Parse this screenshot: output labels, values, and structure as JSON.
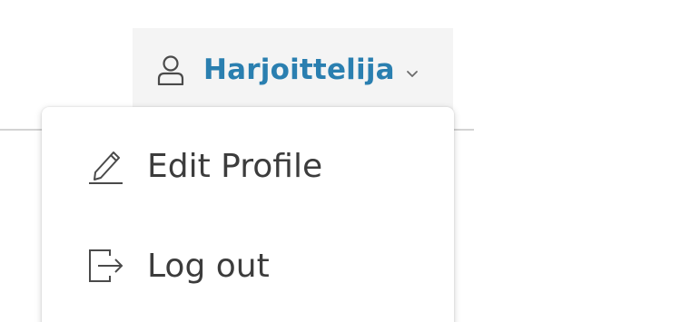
{
  "user_menu": {
    "username": "Harjoittelija",
    "user_icon": "user-icon",
    "chevron_icon": "chevron-down-icon",
    "accent_color": "#2a7fb0"
  },
  "dropdown": {
    "items": [
      {
        "label": "Edit Profile",
        "icon": "pencil-icon"
      },
      {
        "label": "Log out",
        "icon": "logout-icon"
      }
    ]
  }
}
